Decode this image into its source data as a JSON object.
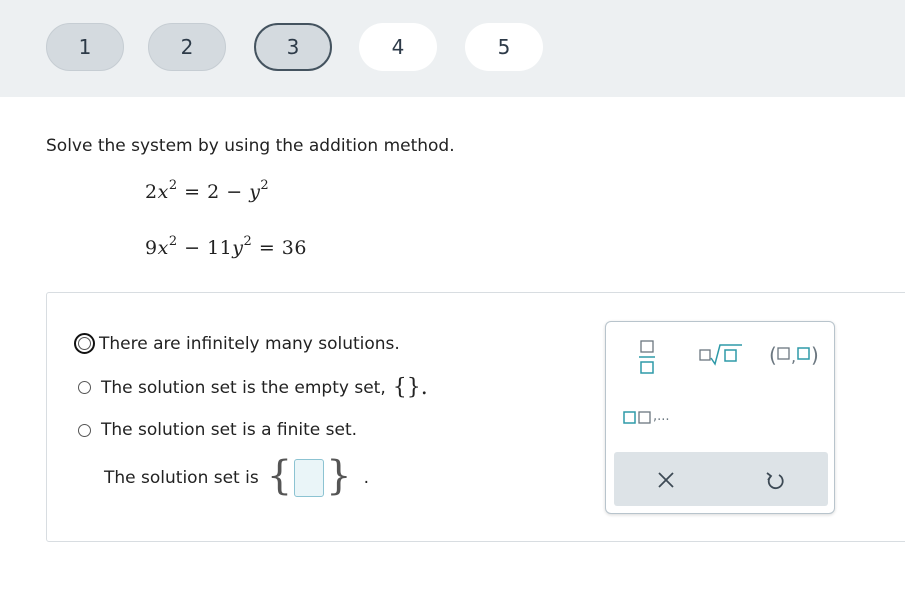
{
  "steps": [
    {
      "label": "1",
      "state": "visited"
    },
    {
      "label": "2",
      "state": "visited"
    },
    {
      "label": "3",
      "state": "current"
    },
    {
      "label": "4",
      "state": "pending"
    },
    {
      "label": "5",
      "state": "pending"
    }
  ],
  "question": {
    "prompt": "Solve the system by using the addition method.",
    "eq1": {
      "a": "2",
      "x": "x",
      "xexp": "2",
      "eq": " = 2 − ",
      "y": "y",
      "yexp": "2"
    },
    "eq2": {
      "a": "9",
      "x": "x",
      "xexp": "2",
      "mid": " − 11",
      "y": "y",
      "yexp": "2",
      "rhs": " = 36"
    }
  },
  "options": {
    "infinite": "There are infinitely many solutions.",
    "empty": "The solution set is the empty set,",
    "empty_symbol": "{}.",
    "finite": "The solution set is a finite set."
  },
  "answer": {
    "label": "The solution set is",
    "open_brace": "{",
    "close_brace": "}",
    "period": "."
  },
  "palette": {
    "list_ellipsis": ",..."
  },
  "colors": {
    "accent": "#2e9aa8",
    "topbar": "#edf0f2",
    "step_visited": "#d4dadf"
  },
  "icons": [
    "fraction-icon",
    "nth-root-icon",
    "ordered-pair-icon",
    "list-icon",
    "clear-icon",
    "undo-icon"
  ]
}
